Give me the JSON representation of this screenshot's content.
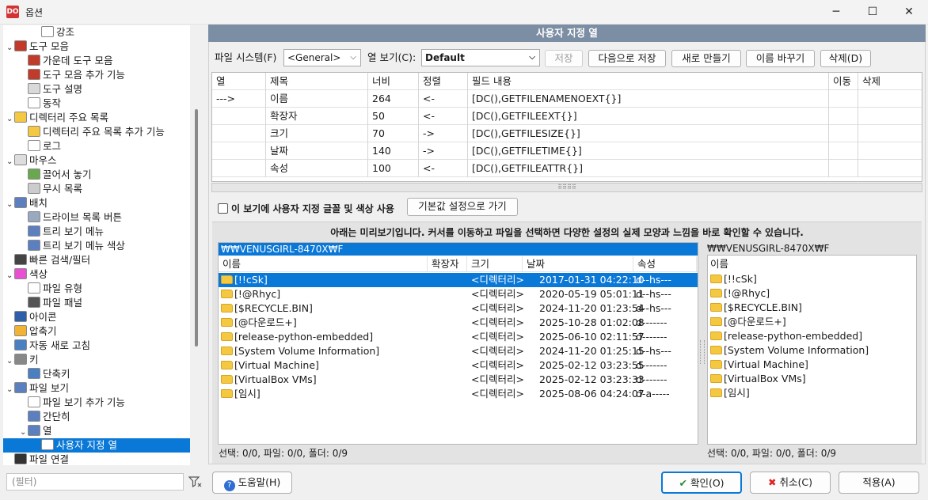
{
  "window": {
    "title": "옵션",
    "icon": "DO",
    "minimize": "─",
    "maximize": "☐",
    "close": "✕"
  },
  "tree": [
    {
      "label": "강조",
      "icon": "doc-icon",
      "color": "#ffffff"
    },
    {
      "label": "도구 모음",
      "icon": "tools-icon",
      "color": "#c23a2a"
    },
    {
      "label": "가운데 도구 모음",
      "icon": "tools-icon",
      "color": "#c23a2a"
    },
    {
      "label": "도구 모음 추가 기능",
      "icon": "tools-icon",
      "color": "#c23a2a"
    },
    {
      "label": "도구 설명",
      "icon": "bulb-icon",
      "color": "#d9d9d9"
    },
    {
      "label": "동작",
      "icon": "doc-icon",
      "color": "#ffffff"
    },
    {
      "label": "디렉터리 주요 목록",
      "icon": "folder-icon",
      "color": "#f5c842"
    },
    {
      "label": "디렉터리 주요 목록 추가 기능",
      "icon": "folder-icon",
      "color": "#f5c842"
    },
    {
      "label": "로그",
      "icon": "log-icon",
      "color": "#ffffff"
    },
    {
      "label": "마우스",
      "icon": "mouse-icon",
      "color": "#dddddd"
    },
    {
      "label": "끌어서 놓기",
      "icon": "drag-icon",
      "color": "#6aa84f"
    },
    {
      "label": "무시 목록",
      "icon": "disc-icon",
      "color": "#cccccc"
    },
    {
      "label": "배치",
      "icon": "layout-icon",
      "color": "#5b7fbf"
    },
    {
      "label": "드라이브 목록 버튼",
      "icon": "drive-icon",
      "color": "#9aa9c0"
    },
    {
      "label": "트리 보기 메뉴",
      "icon": "layout-icon",
      "color": "#5b7fbf"
    },
    {
      "label": "트리 보기 메뉴 색상",
      "icon": "layout-icon",
      "color": "#5b7fbf"
    },
    {
      "label": "빠른 검색/필터",
      "icon": "binoculars-icon",
      "color": "#444444"
    },
    {
      "label": "색상",
      "icon": "color-wheel-icon",
      "color": "#e84fd2"
    },
    {
      "label": "파일 유형",
      "icon": "doc-icon",
      "color": "#ffffff"
    },
    {
      "label": "파일 패널",
      "icon": "panel-icon",
      "color": "#555555"
    },
    {
      "label": "아이콘",
      "icon": "footprint-icon",
      "color": "#2e5fa8"
    },
    {
      "label": "압축기",
      "icon": "archive-icon",
      "color": "#f2b233"
    },
    {
      "label": "자동 새로 고침",
      "icon": "refresh-icon",
      "color": "#4a7fc1"
    },
    {
      "label": "키",
      "icon": "keyboard-icon",
      "color": "#888888"
    },
    {
      "label": "단축키",
      "icon": "shortcut-icon",
      "color": "#4a7fc1"
    },
    {
      "label": "파일 보기",
      "icon": "layout-icon",
      "color": "#5b7fbf"
    },
    {
      "label": "파일 보기 추가 기능",
      "icon": "doc-icon",
      "color": "#ffffff"
    },
    {
      "label": "간단히",
      "icon": "grid-icon",
      "color": "#5b7fbf"
    },
    {
      "label": "열",
      "icon": "columns-icon",
      "color": "#5b7fbf"
    },
    {
      "label": "사용자 지정 열",
      "icon": "table-icon",
      "color": "#ffffff"
    },
    {
      "label": "파일 연결",
      "icon": "link-icon",
      "color": "#333333"
    }
  ],
  "filter_placeholder": "(필터)",
  "header": "사용자 지정 열",
  "toolbar": {
    "fs_label": "파일 시스템(F)",
    "fs_value": "<General>",
    "view_label": "열 보기(C):",
    "view_value": "Default",
    "save": "저장",
    "save_as": "다음으로 저장",
    "new": "새로 만들기",
    "rename": "이름 바꾸기",
    "delete": "삭제(D)"
  },
  "columns_table": {
    "headers": [
      "열",
      "제목",
      "너비",
      "정렬",
      "필드 내용",
      "이동",
      "삭제"
    ],
    "rows": [
      [
        "--->",
        "이름",
        "264",
        "<-",
        "[DC(),GETFILENAMENOEXT{}]"
      ],
      [
        "",
        "확장자",
        "50",
        "<-",
        "[DC(),GETFILEEXT{}]"
      ],
      [
        "",
        "크기",
        "70",
        "->",
        "[DC(),GETFILESIZE{}]"
      ],
      [
        "",
        "날짜",
        "140",
        "->",
        "[DC(),GETFILETIME{}]"
      ],
      [
        "",
        "속성",
        "100",
        "<-",
        "[DC(),GETFILEATTR{}]"
      ]
    ]
  },
  "custom_font_label": "이 보기에 사용자 지정 글꼴 및 색상 사용",
  "defaults_button": "기본값 설정으로 가기",
  "preview_note": "아래는 미리보기입니다. 커서를 이동하고 파일을 선택하면 다양한 설정의 실제 모양과 느낌을 바로 확인할 수 있습니다.",
  "preview": {
    "path": "₩₩VENUSGIRL-8470X₩F",
    "headers": [
      "이름",
      "확장자",
      "크기",
      "날짜",
      "속성"
    ],
    "rows": [
      [
        "[!!cSk]",
        "<디렉터리>",
        "2017-01-31 04:22:10",
        "d--hs---"
      ],
      [
        "[!@Rhyc]",
        "<디렉터리>",
        "2020-05-19 05:01:11",
        "d--hs---"
      ],
      [
        "[$RECYCLE.BIN]",
        "<디렉터리>",
        "2024-11-20 01:23:54",
        "d--hs---"
      ],
      [
        "[@다운로드+]",
        "<디렉터리>",
        "2025-10-28 01:02:08",
        "d-------"
      ],
      [
        "[release-python-embedded]",
        "<디렉터리>",
        "2025-06-10 02:11:57",
        "d-------"
      ],
      [
        "[System Volume Information]",
        "<디렉터리>",
        "2024-11-20 01:25:15",
        "d--hs---"
      ],
      [
        "[Virtual Machine]",
        "<디렉터리>",
        "2025-02-12 03:23:55",
        "d-------"
      ],
      [
        "[VirtualBox VMs]",
        "<디렉터리>",
        "2025-02-12 03:23:33",
        "d-------"
      ],
      [
        "[임시]",
        "<디렉터리>",
        "2025-08-06 04:24:07",
        "d-a-----"
      ]
    ],
    "status": "선택: 0/0, 파일: 0/0, 폴더: 0/9",
    "mini_path": "₩₩VENUSGIRL-8470X₩F",
    "mini_header": "이름",
    "mini_status": "선택: 0/0, 파일: 0/0, 폴더: 0/9"
  },
  "buttons": {
    "help": "도움말(H)",
    "ok": "확인(O)",
    "cancel": "취소(C)",
    "apply": "적용(A)"
  }
}
